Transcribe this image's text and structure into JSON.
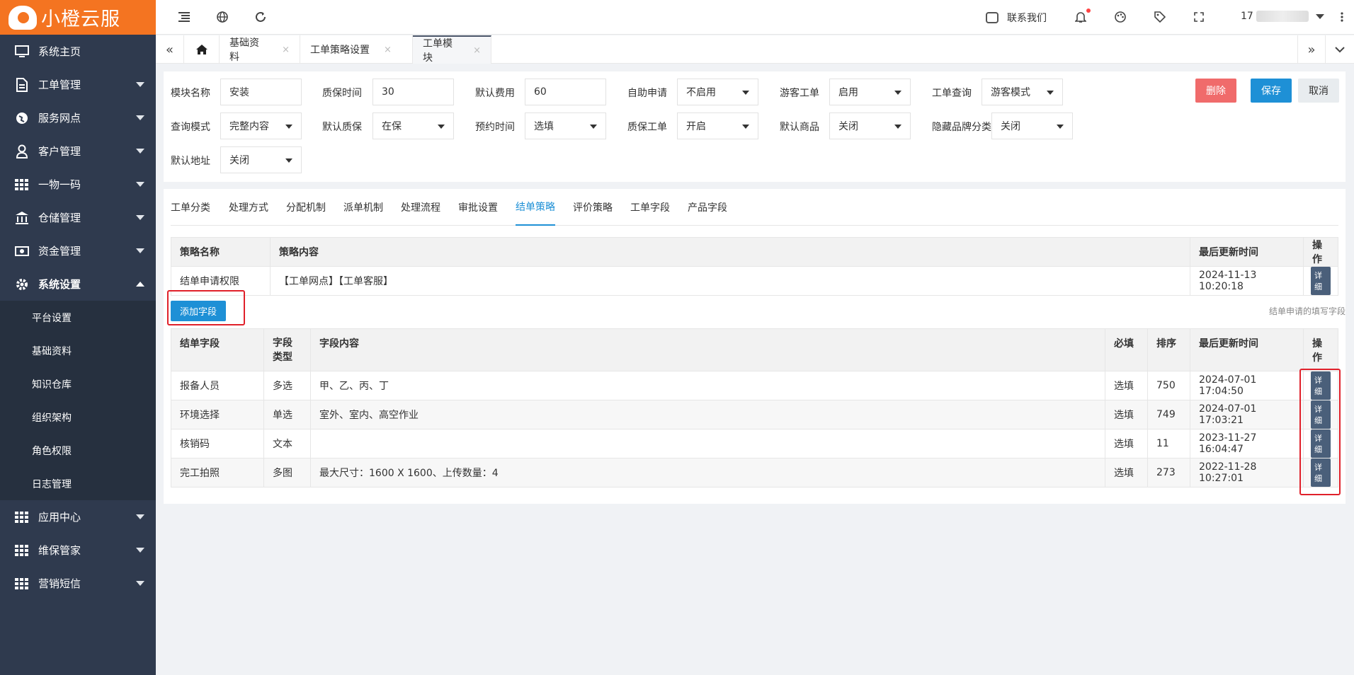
{
  "brand": {
    "name": "小橙云服"
  },
  "sidebar": {
    "items": [
      {
        "label": "系统主页",
        "icon": "monitor-icon"
      },
      {
        "label": "工单管理",
        "icon": "document-icon"
      },
      {
        "label": "服务网点",
        "icon": "globe-icon"
      },
      {
        "label": "客户管理",
        "icon": "user-icon"
      },
      {
        "label": "一物一码",
        "icon": "grid-icon"
      },
      {
        "label": "仓储管理",
        "icon": "bank-icon"
      },
      {
        "label": "资金管理",
        "icon": "money-icon"
      },
      {
        "label": "系统设置",
        "icon": "gear-icon"
      }
    ],
    "sub_items": [
      "平台设置",
      "基础资料",
      "知识仓库",
      "组织架构",
      "角色权限",
      "日志管理"
    ],
    "bottom_items": [
      {
        "label": "应用中心",
        "icon": "grid-icon"
      },
      {
        "label": "维保管家",
        "icon": "grid-icon"
      },
      {
        "label": "营销短信",
        "icon": "grid-icon"
      }
    ]
  },
  "topbar": {
    "contact": "联系我们",
    "user": "17"
  },
  "tabs": {
    "items": [
      "基础资料",
      "工单策略设置",
      "工单模块"
    ],
    "close": "×"
  },
  "form": {
    "row1": [
      {
        "label": "模块名称",
        "value": "安装"
      },
      {
        "label": "质保时间",
        "value": "30"
      },
      {
        "label": "默认费用",
        "value": "60"
      },
      {
        "label": "自助申请",
        "value": "不启用"
      },
      {
        "label": "游客工单",
        "value": "启用"
      },
      {
        "label": "工单查询",
        "value": "游客模式"
      }
    ],
    "row2": [
      {
        "label": "查询模式",
        "value": "完整内容"
      },
      {
        "label": "默认质保",
        "value": "在保"
      },
      {
        "label": "预约时间",
        "value": "选填"
      },
      {
        "label": "质保工单",
        "value": "开启"
      },
      {
        "label": "默认商品",
        "value": "关闭"
      },
      {
        "label": "隐藏品牌分类",
        "value": "关闭"
      }
    ],
    "row3": [
      {
        "label": "默认地址",
        "value": "关闭"
      }
    ],
    "buttons": {
      "delete": "删除",
      "save": "保存",
      "cancel": "取消"
    }
  },
  "section_tabs": [
    "工单分类",
    "处理方式",
    "分配机制",
    "派单机制",
    "处理流程",
    "审批设置",
    "结单策略",
    "评价策略",
    "工单字段",
    "产品字段"
  ],
  "strategy_table": {
    "headers": [
      "策略名称",
      "策略内容",
      "最后更新时间",
      "操作"
    ],
    "rows": [
      [
        "结单申请权限",
        "【工单网点】【工单客服】",
        "2024-11-13 10:20:18",
        "详细"
      ]
    ]
  },
  "add_field": {
    "label": "添加字段",
    "hint": "结单申请的填写字段"
  },
  "field_table": {
    "headers": [
      "结单字段",
      "字段类型",
      "字段内容",
      "必填",
      "排序",
      "最后更新时间",
      "操作"
    ],
    "rows": [
      [
        "报备人员",
        "多选",
        "甲、乙、丙、丁",
        "选填",
        "750",
        "2024-07-01 17:04:50",
        "详细"
      ],
      [
        "环境选择",
        "单选",
        "室外、室内、高空作业",
        "选填",
        "749",
        "2024-07-01 17:03:21",
        "详细"
      ],
      [
        "核销码",
        "文本",
        "",
        "选填",
        "11",
        "2023-11-27 16:04:47",
        "详细"
      ],
      [
        "完工拍照",
        "多图",
        "最大尺寸：1600 X 1600、上传数量：4",
        "选填",
        "273",
        "2022-11-28 10:27:01",
        "详细"
      ]
    ]
  },
  "colors": {
    "accent": "#1e90d6",
    "brand": "#f47421",
    "sidebar": "#2f3a4e",
    "danger": "#f06b6b"
  }
}
